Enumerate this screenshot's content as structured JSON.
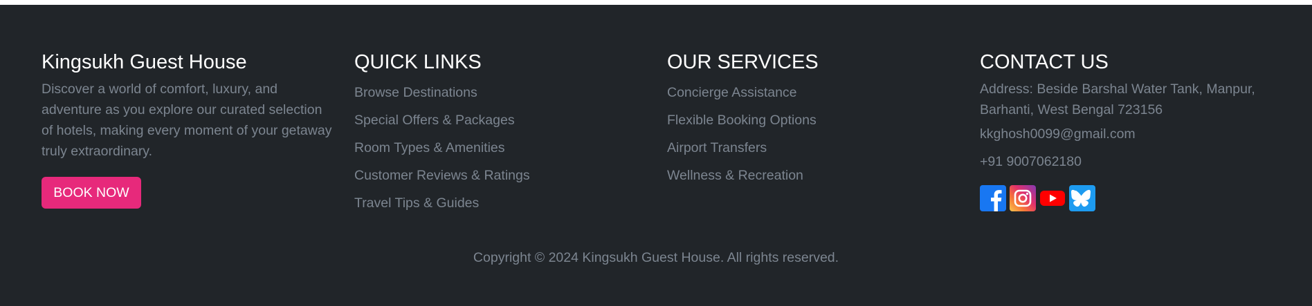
{
  "brand": {
    "name": "Kingsukh Guest House",
    "description": "Discover a world of comfort, luxury, and adventure as you explore our curated selection of hotels, making every moment of your getaway truly extraordinary.",
    "cta_label": "BOOK NOW",
    "cta_color": "#e7297b"
  },
  "quick_links": {
    "heading": "QUICK LINKS",
    "items": [
      {
        "label": "Browse Destinations"
      },
      {
        "label": "Special Offers & Packages"
      },
      {
        "label": "Room Types & Amenities"
      },
      {
        "label": "Customer Reviews & Ratings"
      },
      {
        "label": "Travel Tips & Guides"
      }
    ]
  },
  "services": {
    "heading": "OUR SERVICES",
    "items": [
      {
        "label": "Concierge Assistance"
      },
      {
        "label": "Flexible Booking Options"
      },
      {
        "label": "Airport Transfers"
      },
      {
        "label": "Wellness & Recreation"
      }
    ]
  },
  "contact": {
    "heading": "CONTACT US",
    "address": "Address: Beside Barshal Water Tank, Manpur, Barhanti, West Bengal 723156",
    "email": "kkghosh0099@gmail.com",
    "phone": "+91 9007062180",
    "social": [
      {
        "icon": "facebook-icon",
        "color": "#1877f2"
      },
      {
        "icon": "instagram-icon",
        "color": "#e1306c"
      },
      {
        "icon": "youtube-icon",
        "color": "#ff0000"
      },
      {
        "icon": "bluesky-icon",
        "color": "#1d9bf0"
      }
    ]
  },
  "copyright": "Copyright © 2024 Kingsukh Guest House. All rights reserved.",
  "colors": {
    "footer_bg": "#212529",
    "muted_text": "#7c8590",
    "heading_text": "#ffffff"
  }
}
